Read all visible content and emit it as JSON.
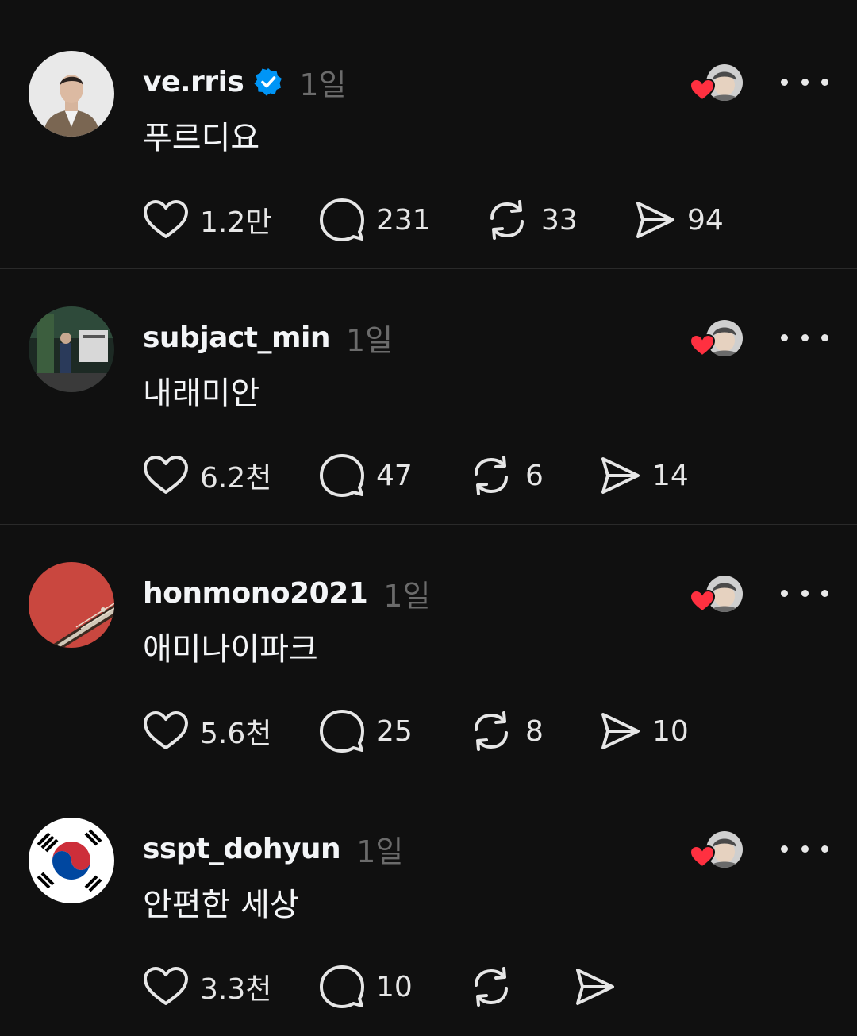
{
  "colors": {
    "background": "#101010",
    "divider": "#2a2a2a",
    "text": "#f3f5f7",
    "muted": "#6b6b6b",
    "verified": "#0095f6",
    "heart": "#ff3040"
  },
  "posts": [
    {
      "username": "ve.rris",
      "verified": true,
      "time": "1일",
      "text": "푸르디요",
      "avatar_icon": "man-in-suit-avatar",
      "likes": "1.2만",
      "comments": "231",
      "reposts": "33",
      "shares": "94"
    },
    {
      "username": "subjact_min",
      "verified": false,
      "time": "1일",
      "text": "내래미안",
      "avatar_icon": "street-scene-avatar",
      "likes": "6.2천",
      "comments": "47",
      "reposts": "6",
      "shares": "14"
    },
    {
      "username": "honmono2021",
      "verified": false,
      "time": "1일",
      "text": "애미나이파크",
      "avatar_icon": "red-guitar-avatar",
      "likes": "5.6천",
      "comments": "25",
      "reposts": "8",
      "shares": "10"
    },
    {
      "username": "sspt_dohyun",
      "verified": false,
      "time": "1일",
      "text": "안편한 세상",
      "avatar_icon": "korean-flag-avatar",
      "likes": "3.3천",
      "comments": "10",
      "reposts": "",
      "shares": ""
    }
  ]
}
